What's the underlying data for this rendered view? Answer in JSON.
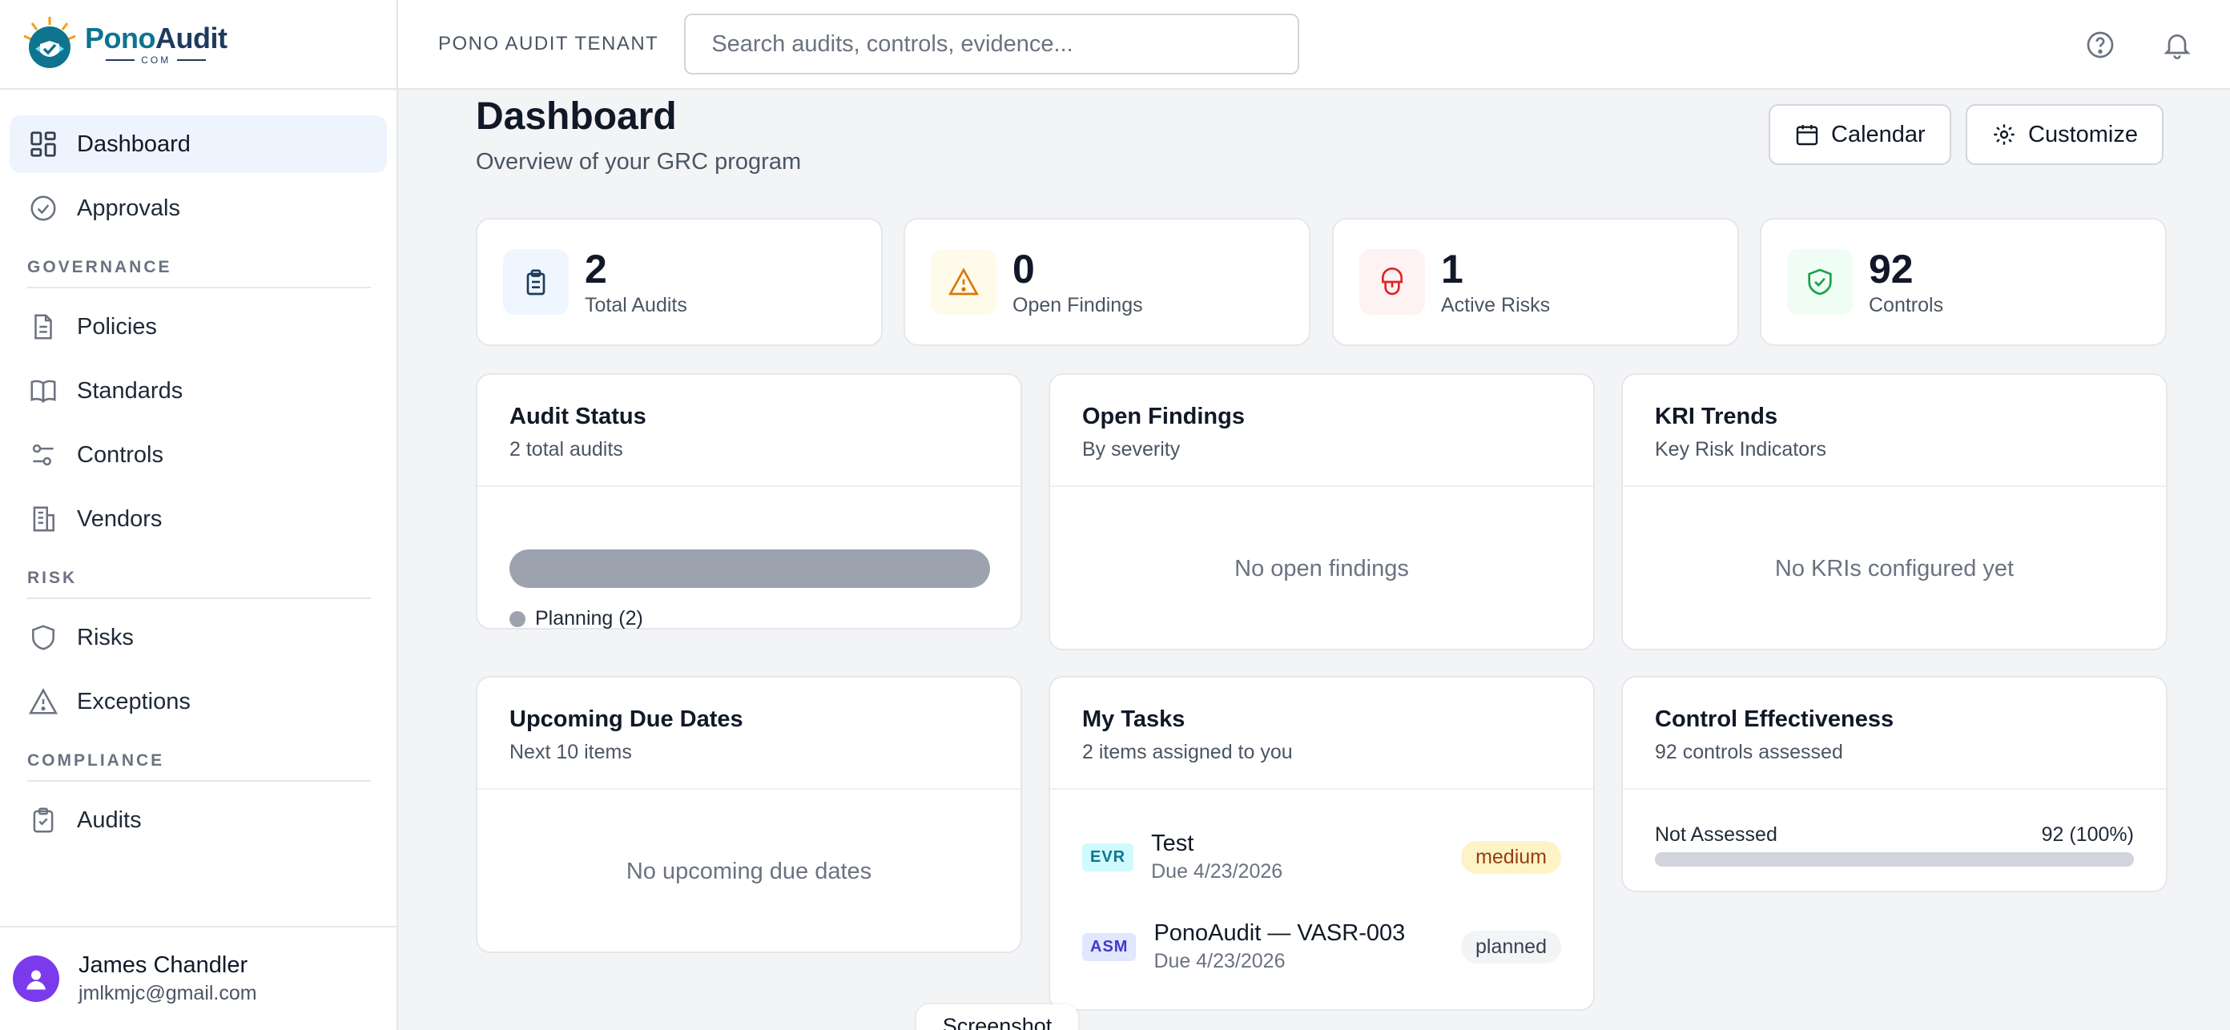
{
  "brand": {
    "name_part1": "Pono",
    "name_part2": "Audit",
    "sub": "COM"
  },
  "sidebar": {
    "items": [
      {
        "label": "Dashboard",
        "icon": "dashboard-icon",
        "active": true
      },
      {
        "label": "Approvals",
        "icon": "check-circle-icon"
      }
    ],
    "sections": [
      {
        "title": "GOVERNANCE",
        "items": [
          {
            "label": "Policies",
            "icon": "document-icon"
          },
          {
            "label": "Standards",
            "icon": "book-icon"
          },
          {
            "label": "Controls",
            "icon": "sliders-icon"
          },
          {
            "label": "Vendors",
            "icon": "building-icon"
          }
        ]
      },
      {
        "title": "RISK",
        "items": [
          {
            "label": "Risks",
            "icon": "shield-icon"
          },
          {
            "label": "Exceptions",
            "icon": "warning-icon"
          }
        ]
      },
      {
        "title": "COMPLIANCE",
        "items": [
          {
            "label": "Audits",
            "icon": "clipboard-icon"
          }
        ]
      }
    ]
  },
  "user": {
    "name": "James Chandler",
    "email": "jmlkmjc@gmail.com"
  },
  "header": {
    "tenant": "PONO AUDIT TENANT",
    "search_placeholder": "Search audits, controls, evidence..."
  },
  "page": {
    "title": "Dashboard",
    "subtitle": "Overview of your GRC program",
    "calendar_label": "Calendar",
    "customize_label": "Customize"
  },
  "stats": [
    {
      "value": "2",
      "label": "Total Audits",
      "color": "#2563eb",
      "bg": "#eff6ff"
    },
    {
      "value": "0",
      "label": "Open Findings",
      "color": "#d97706",
      "bg": "#fffbeb"
    },
    {
      "value": "1",
      "label": "Active Risks",
      "color": "#dc2626",
      "bg": "#fef2f2"
    },
    {
      "value": "92",
      "label": "Controls",
      "color": "#16a34a",
      "bg": "#f0fdf4"
    }
  ],
  "cards": {
    "audit_status": {
      "title": "Audit Status",
      "subtitle": "2 total audits",
      "legend": "Planning (2)"
    },
    "open_findings": {
      "title": "Open Findings",
      "subtitle": "By severity",
      "empty": "No open findings"
    },
    "kri_trends": {
      "title": "KRI Trends",
      "subtitle": "Key Risk Indicators",
      "empty": "No KRIs configured yet"
    },
    "due_dates": {
      "title": "Upcoming Due Dates",
      "subtitle": "Next 10 items",
      "empty": "No upcoming due dates"
    },
    "my_tasks": {
      "title": "My Tasks",
      "subtitle": "2 items assigned to you",
      "tasks": [
        {
          "tag": "EVR",
          "name": "Test",
          "due": "Due 4/23/2026",
          "status": "medium"
        },
        {
          "tag": "ASM",
          "name": "PonoAudit — VASR-003",
          "due": "Due 4/23/2026",
          "status": "planned"
        }
      ]
    },
    "control_effectiveness": {
      "title": "Control Effectiveness",
      "subtitle": "92 controls assessed",
      "row_label": "Not Assessed",
      "row_value": "92 (100%)",
      "fraction": 1.0
    }
  },
  "tooltip": "Screenshot"
}
